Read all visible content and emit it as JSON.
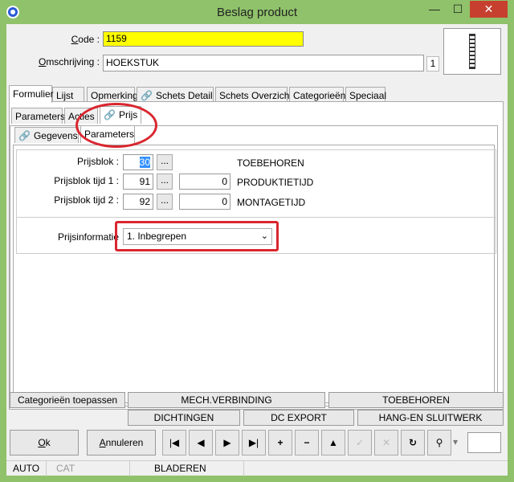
{
  "window": {
    "title": "Beslag product",
    "minimize_glyph": "—",
    "maximize_glyph": "☐",
    "close_glyph": "✕"
  },
  "header": {
    "code_label_prefix": "C",
    "code_label_rest": "ode :",
    "code_value": "1159",
    "desc_label_prefix": "O",
    "desc_label_rest": "mschrijving :",
    "desc_value": "HOEKSTUK",
    "count": "1"
  },
  "tabs_main": [
    {
      "label": "Formulier"
    },
    {
      "label": "Lijst"
    },
    {
      "label": "Opmerking"
    },
    {
      "label": "Schets Detail"
    },
    {
      "label": "Schets Overzicht"
    },
    {
      "label": "Categorieën"
    },
    {
      "label": "Speciaal"
    }
  ],
  "tabs_sub": [
    {
      "label": "Parameters"
    },
    {
      "label": "Acties"
    },
    {
      "label": "Prijs"
    }
  ],
  "tabs_third": [
    {
      "label": "Gegevens"
    },
    {
      "label": "Parameters"
    }
  ],
  "prices": {
    "rows": [
      {
        "label": "Prijsblok :",
        "number": "30",
        "value": "",
        "caption": "TOEBEHOREN"
      },
      {
        "label": "Prijsblok tijd 1 :",
        "number": "91",
        "value": "0",
        "caption": "PRODUKTIETIJD"
      },
      {
        "label": "Prijsblok tijd 2 :",
        "number": "92",
        "value": "0",
        "caption": "MONTAGETIJD"
      }
    ],
    "ellipsis": "...",
    "info_label": "Prijsinformatie",
    "info_selected": "1.  Inbegrepen"
  },
  "actions": {
    "categories_apply": "Categorieën toepassen",
    "mech": "MECH.VERBINDING",
    "toebehoren": "TOEBEHOREN",
    "dichtingen": "DICHTINGEN",
    "dc_export": "DC EXPORT",
    "hang": "HANG-EN SLUITWERK"
  },
  "footer": {
    "ok_prefix": "O",
    "ok_rest": "k",
    "cancel_prefix": "A",
    "cancel_rest": "nnuleren",
    "nav": {
      "first": "|◀",
      "prev": "◀",
      "next": "▶",
      "last": "▶|",
      "add": "+",
      "remove": "−",
      "up": "▲",
      "confirm": "✓",
      "cancel": "✕",
      "refresh": "↻",
      "find": "⚲",
      "dropdown": "▾"
    }
  },
  "status": {
    "mode": "AUTO",
    "cat": "CAT",
    "state": "BLADEREN"
  }
}
